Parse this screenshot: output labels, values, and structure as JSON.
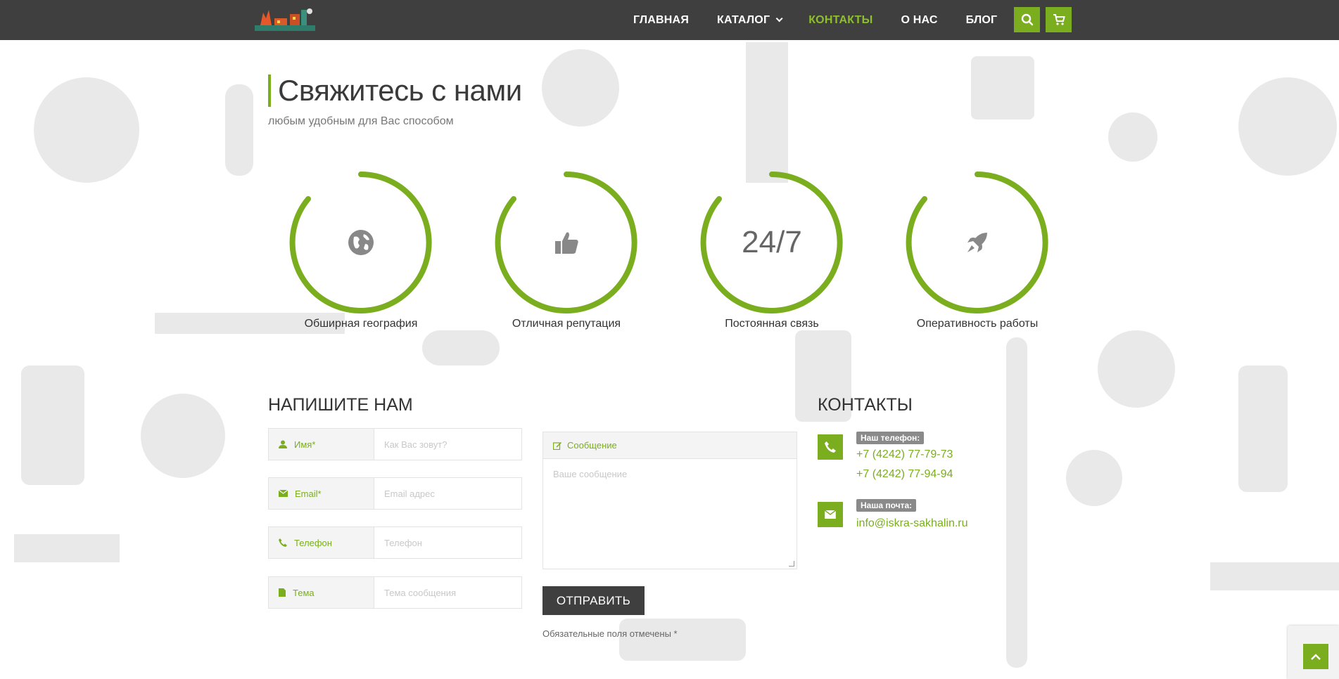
{
  "nav": {
    "items": [
      {
        "label": "ГЛАВНАЯ"
      },
      {
        "label": "КАТАЛОГ"
      },
      {
        "label": "КОНТАКТЫ"
      },
      {
        "label": "О НАС"
      },
      {
        "label": "БЛОГ"
      }
    ],
    "active": "КОНТАКТЫ"
  },
  "hero": {
    "title": "Свяжитесь с нами",
    "subtitle": "любым удобным для Вас способом"
  },
  "features": [
    {
      "icon": "globe-icon",
      "label": "Обширная география"
    },
    {
      "icon": "thumbs-up-icon",
      "label": "Отличная репутация"
    },
    {
      "icon": "text-24-7",
      "value": "24/7",
      "label": "Постоянная связь"
    },
    {
      "icon": "rocket-icon",
      "label": "Оперативность работы"
    }
  ],
  "form": {
    "title": "НАПИШИТЕ НАМ",
    "fields": [
      {
        "icon": "user-icon",
        "label": "Имя*",
        "placeholder": "Как Вас зовут?"
      },
      {
        "icon": "envelope-icon",
        "label": "Email*",
        "placeholder": "Email адрес"
      },
      {
        "icon": "phone-icon",
        "label": "Телефон",
        "placeholder": "Телефон"
      },
      {
        "icon": "file-icon",
        "label": "Тема",
        "placeholder": "Тема сообщения"
      }
    ],
    "message": {
      "icon": "edit-icon",
      "label": "Сообщение",
      "placeholder": "Ваше сообщение"
    },
    "submit": "ОТПРАВИТЬ",
    "required_note": "Обязательные поля отмечены *"
  },
  "contacts": {
    "title": "КОНТАКТЫ",
    "phone_badge": "Наш телефон:",
    "phones": [
      "+7 (4242) 77-79-73",
      "+7 (4242) 77-94-94"
    ],
    "email_badge": "Наша почта:",
    "email": "info@iskra-sakhalin.ru"
  },
  "colors": {
    "accent": "#7aae1e",
    "header_bg": "#3f3f3f",
    "text": "#333333"
  }
}
